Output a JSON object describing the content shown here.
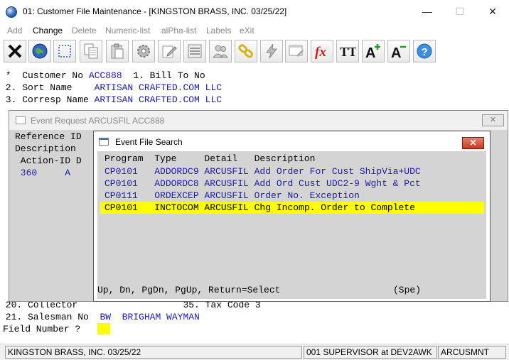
{
  "window": {
    "title": "01: Customer File Maintenance - [KINGSTON BRASS, INC. 03/25/22]",
    "minimize_glyph": "—",
    "maximize_glyph": "☐",
    "close_glyph": "✕"
  },
  "menu": {
    "items": [
      {
        "label": "Add"
      },
      {
        "label": "Change"
      },
      {
        "label": "Delete"
      },
      {
        "label": "Numeric-list"
      },
      {
        "label": "alPha-list"
      },
      {
        "label": "Labels"
      },
      {
        "label": "eXit"
      }
    ],
    "active": "Change"
  },
  "toolbar": {
    "buttons": [
      "close-x-icon",
      "globe-icon",
      "select-rect-icon",
      "copy-icon",
      "paste-icon",
      "gear-icon",
      "edit-icon",
      "list-icon",
      "users-icon",
      "link-icon",
      "lightning-icon",
      "window-edit-icon",
      "fx-icon",
      "font-size-icon",
      "font-increase-icon",
      "font-decrease-icon",
      "help-icon"
    ],
    "fx_text": "fx",
    "tt_text": "TT",
    "a_plus_text": "A",
    "a_minus_text": "A",
    "help_text": "?"
  },
  "terminal": {
    "line1": {
      "label": " *  Customer No ",
      "value": "ACC888",
      "suffix": "  1. Bill To No"
    },
    "line2": {
      "label": " 2. Sort Name    ",
      "value": "ARTISAN CRAFTED.COM LLC"
    },
    "line3": {
      "label": " 3. Corresp Name ",
      "value": "ARTISAN CRAFTED.COM LLC"
    },
    "line20": " 20. Collector                   35. Tax Code 3",
    "line21": {
      "label": " 21. Salesman No  ",
      "value": "BW  BRIGHAM WAYMAN"
    },
    "prompt": "Field Number ?"
  },
  "event_request": {
    "title": "Event Request ARCUSFIL ACC888",
    "close_glyph": "✕",
    "line1": "Reference ID",
    "line2": "Description",
    "line3": " Action-ID D",
    "line4_blue": " 360",
    "line4_tail": "     A"
  },
  "event_file_search": {
    "title": "Event File Search",
    "close_glyph": "✕",
    "header": "Program  Type     Detail   Description",
    "rows": [
      {
        "text": "CP0101   ADDORDC9 ARCUSFIL Add Order For Cust ShipVia+UDC",
        "selected": false
      },
      {
        "text": "CP0101   ADDORDC8 ARCUSFIL Add Ord Cust UDC2-9 Wght & Pct",
        "selected": false
      },
      {
        "text": "CP0111   ORDEXCEP ARCUSFIL Order No. Exception",
        "selected": false
      },
      {
        "text": "CP0101   INCTOCOM ARCUSFIL Chg Incomp. Order to Complete",
        "selected": true
      }
    ],
    "footer": "Up, Dn, PgDn, PgUp, Return=Select",
    "footer_right": "(Spe)"
  },
  "status_bar": {
    "company": "KINGSTON BRASS, INC. 03/25/22",
    "user": "001 SUPERVISOR at DEV2AWK",
    "program": "ARCUSMNT"
  },
  "colors": {
    "terminal_blue": "#1c1ca8",
    "highlight_yellow": "#ffff00",
    "dialog_gray": "#d4d4d4",
    "close_red": "#c63a24"
  }
}
